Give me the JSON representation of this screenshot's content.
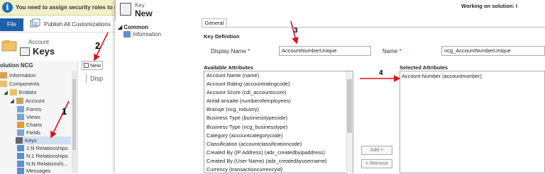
{
  "banner": {
    "text": "You need to assign security roles to new users"
  },
  "toolbar": {
    "file_label": "File",
    "publish_label": "Publish All Customizations"
  },
  "header": {
    "entity": "Account",
    "title": "Keys"
  },
  "solution": {
    "title": "olution NCG"
  },
  "tree": {
    "information": "Information",
    "components": "Components",
    "entities": "Entities",
    "account": "Account",
    "forms": "Forms",
    "views": "Views",
    "charts": "Charts",
    "fields": "Fields",
    "keys": "Keys",
    "rel_1n": "1:N Relationships",
    "rel_n1": "N:1 Relationships",
    "rel_nn": "N:N Relationshi...",
    "messages": "Messages"
  },
  "list": {
    "new_label": "New",
    "column_label": "Disp"
  },
  "dialog": {
    "key_label": "Key",
    "title": "New",
    "working_on": "Working on solution: I",
    "nav": {
      "section": "Common",
      "item": "Information"
    },
    "tab": "General",
    "section_title": "Key Definition",
    "display_name_label": "Display Name",
    "display_name_value": "AccountNumberUnique",
    "name_label": "Name",
    "name_value": "ncg_AccountNumberUnique",
    "available_title": "Available Attributes",
    "selected_title": "Selected Attributes",
    "available": [
      "Account Name (name)",
      "Account Rating (accountratingcode)",
      "Account Score (cdi_accountscore)",
      "Antall ansatte (numberofemployees)",
      "Bransje (ncg_industry)",
      "Business Type (businesstypecode)",
      "Business Type (ncg_businesstype)",
      "Category (accountcategorycode)",
      "Classification (accountclassificationcode)",
      "Created By (IP Address) (adx_createdbyipaddress)",
      "Created By (User Name) (adx_createdbyusername)",
      "Currency (transactioncurrencyid)"
    ],
    "selected": [
      "Account Number (accountnumber)"
    ],
    "add_label": "Add >",
    "remove_label": "< Remove"
  },
  "annotations": {
    "n1": "1",
    "n2": "2",
    "n3": "3",
    "n4": "4"
  },
  "colors": {
    "banner": "#f3f0c8",
    "file": "#1e5fa8",
    "arrow": "#e0101a"
  }
}
